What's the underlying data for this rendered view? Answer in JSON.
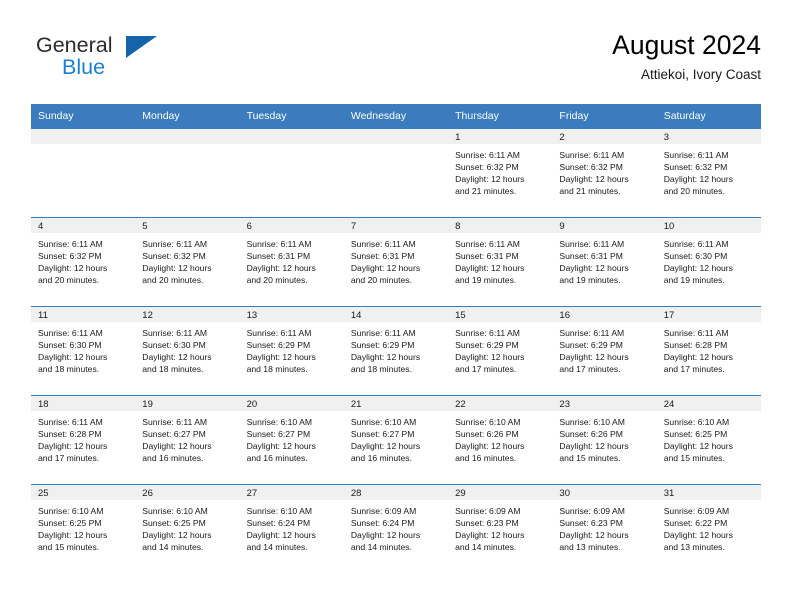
{
  "brand": {
    "name_part1": "General",
    "name_part2": "Blue",
    "logo_icon": "blue-triangle-icon",
    "colors": {
      "general": "#2b2b2b",
      "blue": "#1c7fd0",
      "triangle": "#1464aa"
    }
  },
  "header": {
    "title": "August 2024",
    "subtitle": "Attiekoi, Ivory Coast"
  },
  "calendar": {
    "header_bg": "#3a7cbe",
    "daynum_bg": "#f0f0f0",
    "weekdays": [
      "Sunday",
      "Monday",
      "Tuesday",
      "Wednesday",
      "Thursday",
      "Friday",
      "Saturday"
    ],
    "labels": {
      "sunrise": "Sunrise:",
      "sunset": "Sunset:",
      "daylight": "Daylight:"
    },
    "weeks": [
      [
        {
          "day": "",
          "empty": true,
          "sunrise": "",
          "sunset": "",
          "daylight_l1": "",
          "daylight_l2": ""
        },
        {
          "day": "",
          "empty": true,
          "sunrise": "",
          "sunset": "",
          "daylight_l1": "",
          "daylight_l2": ""
        },
        {
          "day": "",
          "empty": true,
          "sunrise": "",
          "sunset": "",
          "daylight_l1": "",
          "daylight_l2": ""
        },
        {
          "day": "",
          "empty": true,
          "sunrise": "",
          "sunset": "",
          "daylight_l1": "",
          "daylight_l2": ""
        },
        {
          "day": "1",
          "empty": false,
          "sunrise": "Sunrise: 6:11 AM",
          "sunset": "Sunset: 6:32 PM",
          "daylight_l1": "Daylight: 12 hours",
          "daylight_l2": "and 21 minutes."
        },
        {
          "day": "2",
          "empty": false,
          "sunrise": "Sunrise: 6:11 AM",
          "sunset": "Sunset: 6:32 PM",
          "daylight_l1": "Daylight: 12 hours",
          "daylight_l2": "and 21 minutes."
        },
        {
          "day": "3",
          "empty": false,
          "sunrise": "Sunrise: 6:11 AM",
          "sunset": "Sunset: 6:32 PM",
          "daylight_l1": "Daylight: 12 hours",
          "daylight_l2": "and 20 minutes."
        }
      ],
      [
        {
          "day": "4",
          "empty": false,
          "sunrise": "Sunrise: 6:11 AM",
          "sunset": "Sunset: 6:32 PM",
          "daylight_l1": "Daylight: 12 hours",
          "daylight_l2": "and 20 minutes."
        },
        {
          "day": "5",
          "empty": false,
          "sunrise": "Sunrise: 6:11 AM",
          "sunset": "Sunset: 6:32 PM",
          "daylight_l1": "Daylight: 12 hours",
          "daylight_l2": "and 20 minutes."
        },
        {
          "day": "6",
          "empty": false,
          "sunrise": "Sunrise: 6:11 AM",
          "sunset": "Sunset: 6:31 PM",
          "daylight_l1": "Daylight: 12 hours",
          "daylight_l2": "and 20 minutes."
        },
        {
          "day": "7",
          "empty": false,
          "sunrise": "Sunrise: 6:11 AM",
          "sunset": "Sunset: 6:31 PM",
          "daylight_l1": "Daylight: 12 hours",
          "daylight_l2": "and 20 minutes."
        },
        {
          "day": "8",
          "empty": false,
          "sunrise": "Sunrise: 6:11 AM",
          "sunset": "Sunset: 6:31 PM",
          "daylight_l1": "Daylight: 12 hours",
          "daylight_l2": "and 19 minutes."
        },
        {
          "day": "9",
          "empty": false,
          "sunrise": "Sunrise: 6:11 AM",
          "sunset": "Sunset: 6:31 PM",
          "daylight_l1": "Daylight: 12 hours",
          "daylight_l2": "and 19 minutes."
        },
        {
          "day": "10",
          "empty": false,
          "sunrise": "Sunrise: 6:11 AM",
          "sunset": "Sunset: 6:30 PM",
          "daylight_l1": "Daylight: 12 hours",
          "daylight_l2": "and 19 minutes."
        }
      ],
      [
        {
          "day": "11",
          "empty": false,
          "sunrise": "Sunrise: 6:11 AM",
          "sunset": "Sunset: 6:30 PM",
          "daylight_l1": "Daylight: 12 hours",
          "daylight_l2": "and 18 minutes."
        },
        {
          "day": "12",
          "empty": false,
          "sunrise": "Sunrise: 6:11 AM",
          "sunset": "Sunset: 6:30 PM",
          "daylight_l1": "Daylight: 12 hours",
          "daylight_l2": "and 18 minutes."
        },
        {
          "day": "13",
          "empty": false,
          "sunrise": "Sunrise: 6:11 AM",
          "sunset": "Sunset: 6:29 PM",
          "daylight_l1": "Daylight: 12 hours",
          "daylight_l2": "and 18 minutes."
        },
        {
          "day": "14",
          "empty": false,
          "sunrise": "Sunrise: 6:11 AM",
          "sunset": "Sunset: 6:29 PM",
          "daylight_l1": "Daylight: 12 hours",
          "daylight_l2": "and 18 minutes."
        },
        {
          "day": "15",
          "empty": false,
          "sunrise": "Sunrise: 6:11 AM",
          "sunset": "Sunset: 6:29 PM",
          "daylight_l1": "Daylight: 12 hours",
          "daylight_l2": "and 17 minutes."
        },
        {
          "day": "16",
          "empty": false,
          "sunrise": "Sunrise: 6:11 AM",
          "sunset": "Sunset: 6:29 PM",
          "daylight_l1": "Daylight: 12 hours",
          "daylight_l2": "and 17 minutes."
        },
        {
          "day": "17",
          "empty": false,
          "sunrise": "Sunrise: 6:11 AM",
          "sunset": "Sunset: 6:28 PM",
          "daylight_l1": "Daylight: 12 hours",
          "daylight_l2": "and 17 minutes."
        }
      ],
      [
        {
          "day": "18",
          "empty": false,
          "sunrise": "Sunrise: 6:11 AM",
          "sunset": "Sunset: 6:28 PM",
          "daylight_l1": "Daylight: 12 hours",
          "daylight_l2": "and 17 minutes."
        },
        {
          "day": "19",
          "empty": false,
          "sunrise": "Sunrise: 6:11 AM",
          "sunset": "Sunset: 6:27 PM",
          "daylight_l1": "Daylight: 12 hours",
          "daylight_l2": "and 16 minutes."
        },
        {
          "day": "20",
          "empty": false,
          "sunrise": "Sunrise: 6:10 AM",
          "sunset": "Sunset: 6:27 PM",
          "daylight_l1": "Daylight: 12 hours",
          "daylight_l2": "and 16 minutes."
        },
        {
          "day": "21",
          "empty": false,
          "sunrise": "Sunrise: 6:10 AM",
          "sunset": "Sunset: 6:27 PM",
          "daylight_l1": "Daylight: 12 hours",
          "daylight_l2": "and 16 minutes."
        },
        {
          "day": "22",
          "empty": false,
          "sunrise": "Sunrise: 6:10 AM",
          "sunset": "Sunset: 6:26 PM",
          "daylight_l1": "Daylight: 12 hours",
          "daylight_l2": "and 16 minutes."
        },
        {
          "day": "23",
          "empty": false,
          "sunrise": "Sunrise: 6:10 AM",
          "sunset": "Sunset: 6:26 PM",
          "daylight_l1": "Daylight: 12 hours",
          "daylight_l2": "and 15 minutes."
        },
        {
          "day": "24",
          "empty": false,
          "sunrise": "Sunrise: 6:10 AM",
          "sunset": "Sunset: 6:25 PM",
          "daylight_l1": "Daylight: 12 hours",
          "daylight_l2": "and 15 minutes."
        }
      ],
      [
        {
          "day": "25",
          "empty": false,
          "sunrise": "Sunrise: 6:10 AM",
          "sunset": "Sunset: 6:25 PM",
          "daylight_l1": "Daylight: 12 hours",
          "daylight_l2": "and 15 minutes."
        },
        {
          "day": "26",
          "empty": false,
          "sunrise": "Sunrise: 6:10 AM",
          "sunset": "Sunset: 6:25 PM",
          "daylight_l1": "Daylight: 12 hours",
          "daylight_l2": "and 14 minutes."
        },
        {
          "day": "27",
          "empty": false,
          "sunrise": "Sunrise: 6:10 AM",
          "sunset": "Sunset: 6:24 PM",
          "daylight_l1": "Daylight: 12 hours",
          "daylight_l2": "and 14 minutes."
        },
        {
          "day": "28",
          "empty": false,
          "sunrise": "Sunrise: 6:09 AM",
          "sunset": "Sunset: 6:24 PM",
          "daylight_l1": "Daylight: 12 hours",
          "daylight_l2": "and 14 minutes."
        },
        {
          "day": "29",
          "empty": false,
          "sunrise": "Sunrise: 6:09 AM",
          "sunset": "Sunset: 6:23 PM",
          "daylight_l1": "Daylight: 12 hours",
          "daylight_l2": "and 14 minutes."
        },
        {
          "day": "30",
          "empty": false,
          "sunrise": "Sunrise: 6:09 AM",
          "sunset": "Sunset: 6:23 PM",
          "daylight_l1": "Daylight: 12 hours",
          "daylight_l2": "and 13 minutes."
        },
        {
          "day": "31",
          "empty": false,
          "sunrise": "Sunrise: 6:09 AM",
          "sunset": "Sunset: 6:22 PM",
          "daylight_l1": "Daylight: 12 hours",
          "daylight_l2": "and 13 minutes."
        }
      ]
    ]
  }
}
